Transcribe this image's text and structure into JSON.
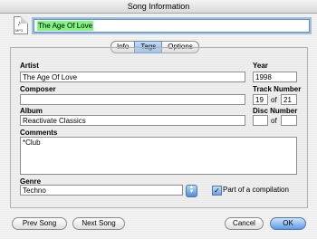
{
  "window": {
    "title": "Song Information"
  },
  "song_title": "The Age Of Love",
  "tabs": [
    "Info",
    "Tags",
    "Options"
  ],
  "active_tab": "Tags",
  "fields": {
    "artist_label": "Artist",
    "artist_value": "The Age Of Love",
    "year_label": "Year",
    "year_value": "1998",
    "composer_label": "Composer",
    "composer_value": "",
    "track_label": "Track Number",
    "track_number": "19",
    "of_label": "of",
    "track_total": "21",
    "album_label": "Album",
    "album_value": "Reactivate Classics",
    "disc_label": "Disc Number",
    "disc_number": "",
    "disc_total": "",
    "comments_label": "Comments",
    "comments_value": "*Club",
    "genre_label": "Genre",
    "genre_value": "Techno",
    "compilation_label": "Part of a compilation"
  },
  "buttons": {
    "prev": "Prev Song",
    "next": "Next Song",
    "cancel": "Cancel",
    "ok": "OK"
  },
  "file_icon": {
    "label": "MP3",
    "glyph": "♪"
  },
  "colors": {
    "selection": "#80f580",
    "accent": "#5d9ce6"
  }
}
